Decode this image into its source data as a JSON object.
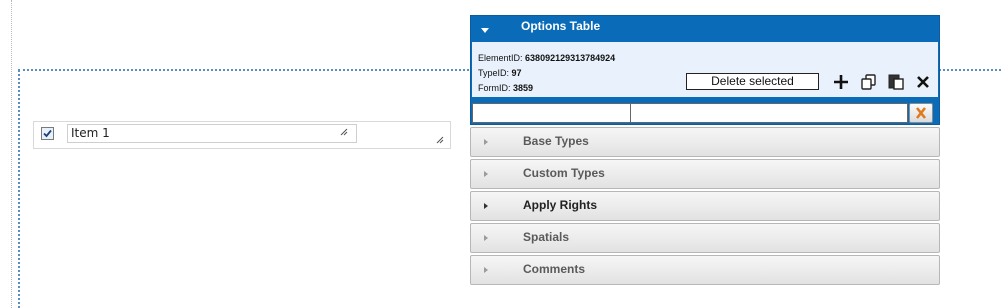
{
  "options_panel": {
    "title": "Options Table",
    "element_id_label": "ElementID:",
    "element_id": "638092129313784924",
    "type_id_label": "TypeID:",
    "type_id": "97",
    "form_id_label": "FormID:",
    "form_id": "3859",
    "delete_label": "Delete selected",
    "icons": [
      "add-icon",
      "copy-icon",
      "paste-icon",
      "close-icon",
      "clear-filter-icon"
    ]
  },
  "accordion": [
    {
      "label": "Base Types",
      "active": false
    },
    {
      "label": "Custom Types",
      "active": false
    },
    {
      "label": "Apply Rights",
      "active": true
    },
    {
      "label": "Spatials",
      "active": false
    },
    {
      "label": "Comments",
      "active": false
    }
  ],
  "item": {
    "checked": true,
    "value": "Item 1"
  },
  "colors": {
    "panel_blue": "#0a6bb8",
    "panel_body": "#e9f2fc",
    "guide_blue": "#5a8ec0"
  }
}
